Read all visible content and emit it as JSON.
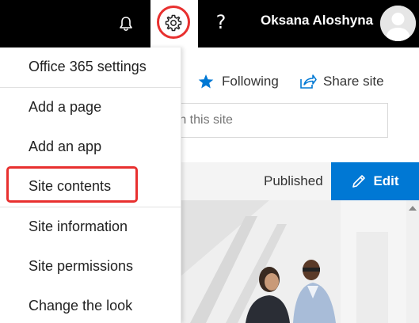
{
  "suite_bar": {
    "user_name": "Oksana Aloshyna",
    "help_label": "?",
    "icons": [
      "bell-icon",
      "gear-icon",
      "help-icon",
      "avatar"
    ]
  },
  "site_actions": {
    "following_label": "Following",
    "share_label": "Share site"
  },
  "search": {
    "visible_text": "rch this site"
  },
  "command_bar": {
    "status": "Published",
    "edit_label": "Edit"
  },
  "settings_menu": {
    "items": [
      "Office 365 settings",
      "Add a page",
      "Add an app",
      "Site contents",
      "Site information",
      "Site permissions",
      "Change the look"
    ],
    "highlighted": "Site contents"
  },
  "colors": {
    "accent": "#0078d4",
    "highlight": "#e8302f",
    "suitebar": "#000000"
  }
}
